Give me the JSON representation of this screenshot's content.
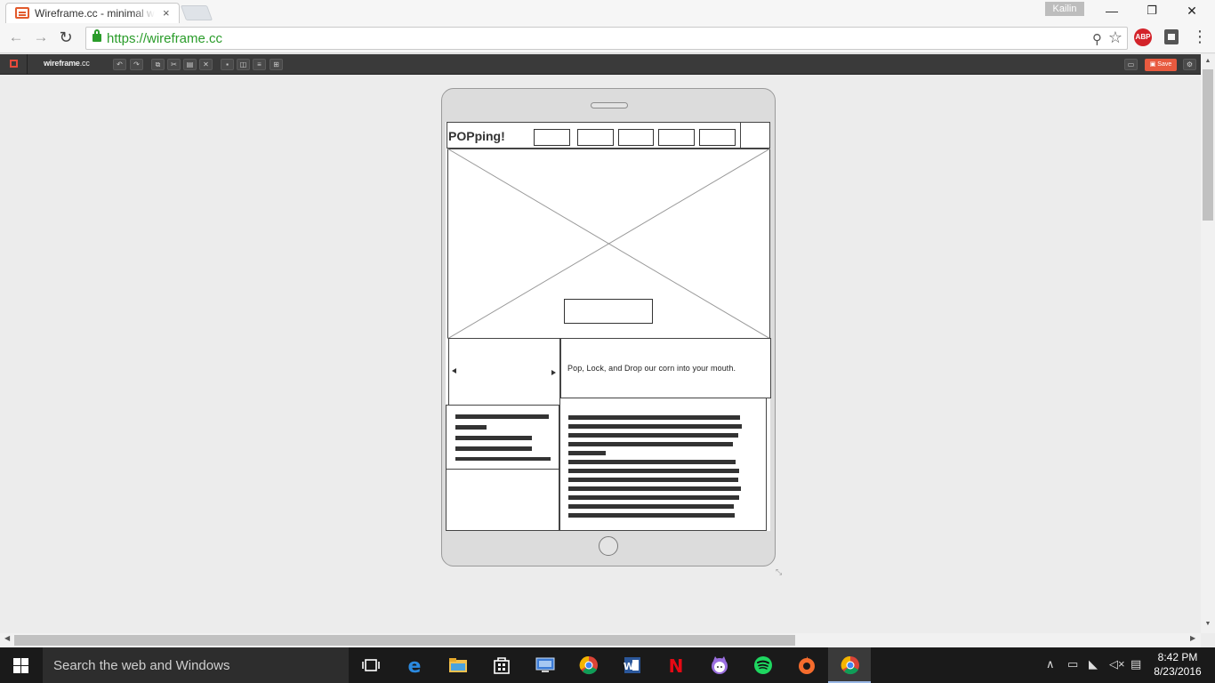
{
  "browser": {
    "tab_title": "Wireframe.cc - minimal wireframing tool",
    "tab_close": "×",
    "profile_name": "Kailin",
    "window_controls": {
      "minimize": "—",
      "restore": "❐",
      "close": "✕"
    },
    "nav": {
      "back": "←",
      "forward": "→",
      "reload": "↻"
    },
    "url": "https://wireframe.cc",
    "zoom_icon": "⚲",
    "star_icon": "☆",
    "abp_label": "ABP",
    "menu_icon": "⋮"
  },
  "app": {
    "brand": "wireframe",
    "brand_suffix": ".cc",
    "save_label": "Save",
    "accent_color": "#e85a3f"
  },
  "wireframe": {
    "logo_text": "POPping!",
    "nav_item_count": 5,
    "hero_caption": "Pop, Lock, and Drop our corn into your mouth."
  },
  "taskbar": {
    "search_placeholder": "Search the web and Windows",
    "time": "8:42 PM",
    "date": "8/23/2016"
  }
}
